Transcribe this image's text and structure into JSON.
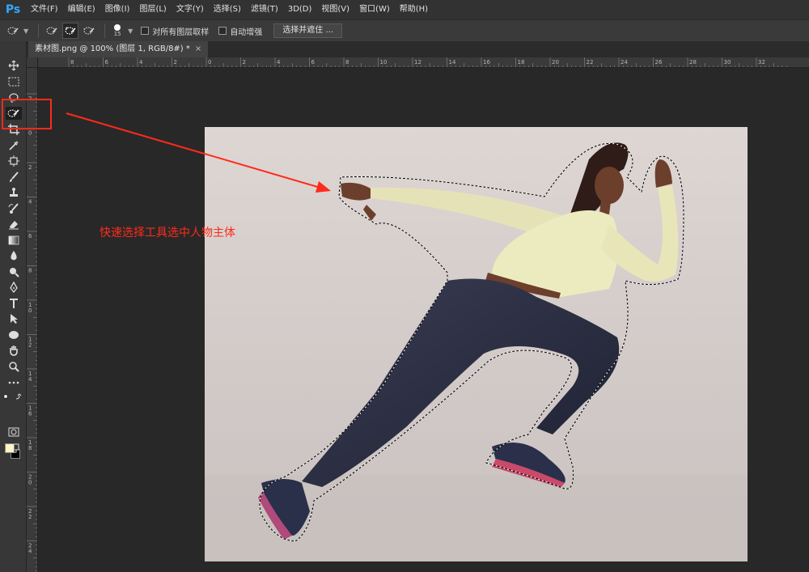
{
  "app": {
    "logo": "Ps"
  },
  "menu": [
    "文件(F)",
    "编辑(E)",
    "图像(I)",
    "图层(L)",
    "文字(Y)",
    "选择(S)",
    "滤镜(T)",
    "3D(D)",
    "视图(V)",
    "窗口(W)",
    "帮助(H)"
  ],
  "options_bar": {
    "brush_size": "15",
    "sample_all_layers_label": "对所有图层取样",
    "auto_enhance_label": "自动增强",
    "select_and_mask_button": "选择并遮住 ..."
  },
  "document": {
    "tab_title": "素材图.png @ 100% (图层 1, RGB/8#) *",
    "close_glyph": "×"
  },
  "rulers": {
    "horizontal_ticks": [
      "8",
      "6",
      "4",
      "2",
      "0",
      "2",
      "4",
      "6",
      "8",
      "10",
      "12",
      "14",
      "16",
      "18",
      "20",
      "22",
      "24",
      "26",
      "28",
      "30",
      "32"
    ],
    "vertical_ticks": [
      "2",
      "0",
      "2",
      "4",
      "6",
      "8",
      "1 0",
      "1 2",
      "1 4",
      "1 6",
      "1 8",
      "2 0",
      "2 2",
      "2 4"
    ]
  },
  "annotation": {
    "text": "快速选择工具选中人物主体",
    "color": "#ff2a1a"
  },
  "colors": {
    "foreground": "#fdf4c8",
    "background": "#000000",
    "ps_blue": "#31a8ff"
  }
}
